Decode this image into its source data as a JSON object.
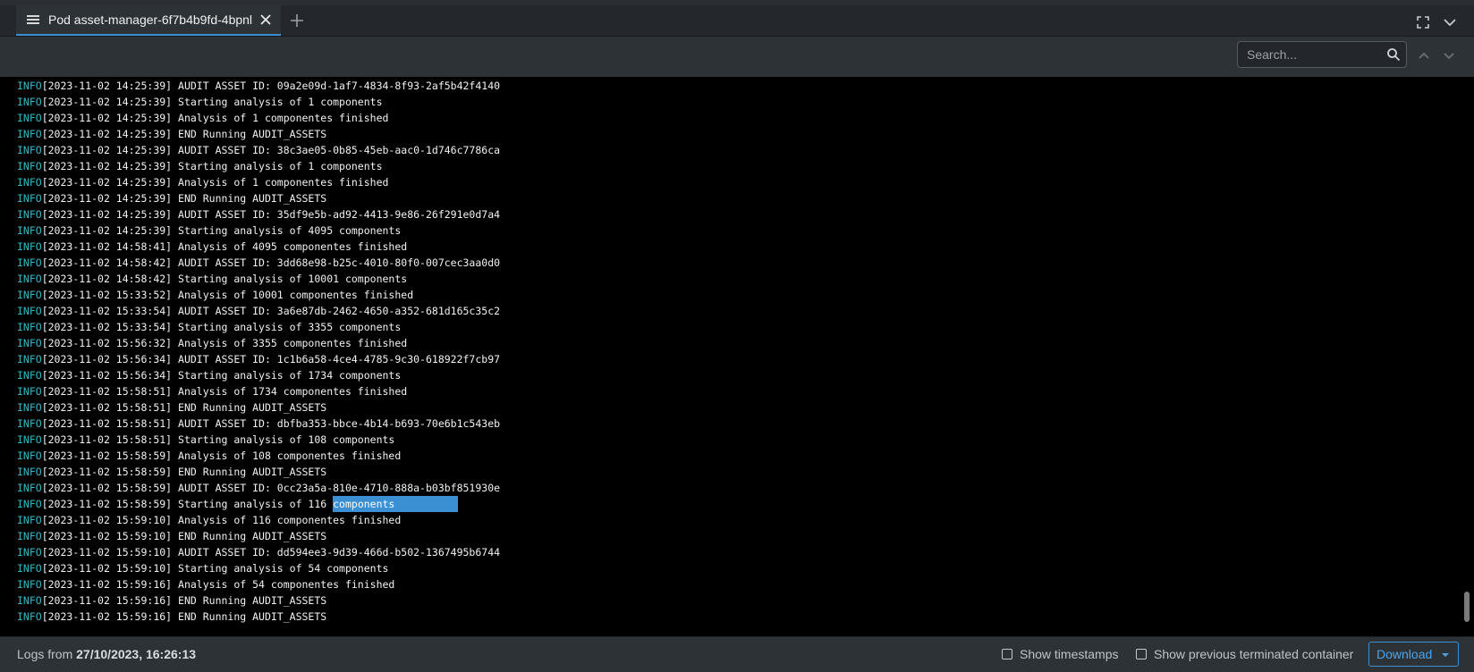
{
  "tabbar": {
    "tab_title": "Pod asset-manager-6f7b4b9fd-4bpnl",
    "tab_icon": "menu-lines-icon",
    "close_icon": "close-icon",
    "add_icon": "plus-icon",
    "fullscreen_icon": "fullscreen-icon",
    "collapse_icon": "chevron-down-icon"
  },
  "toolbar": {
    "search_placeholder": "Search...",
    "search_icon": "search-icon",
    "prev_icon": "chevron-up-icon",
    "next_icon": "chevron-down-icon"
  },
  "logs": {
    "level_label": "INFO",
    "highlighted_text": "components",
    "lines": [
      "[2023-11-02 14:25:39] AUDIT ASSET ID: 09a2e09d-1af7-4834-8f93-2af5b42f4140",
      "[2023-11-02 14:25:39] Starting analysis of 1 components",
      "[2023-11-02 14:25:39] Analysis of 1 componentes finished",
      "[2023-11-02 14:25:39] END Running AUDIT_ASSETS",
      "[2023-11-02 14:25:39] AUDIT ASSET ID: 38c3ae05-0b85-45eb-aac0-1d746c7786ca",
      "[2023-11-02 14:25:39] Starting analysis of 1 components",
      "[2023-11-02 14:25:39] Analysis of 1 componentes finished",
      "[2023-11-02 14:25:39] END Running AUDIT_ASSETS",
      "[2023-11-02 14:25:39] AUDIT ASSET ID: 35df9e5b-ad92-4413-9e86-26f291e0d7a4",
      "[2023-11-02 14:25:39] Starting analysis of 4095 components",
      "[2023-11-02 14:58:41] Analysis of 4095 componentes finished",
      "[2023-11-02 14:58:42] AUDIT ASSET ID: 3dd68e98-b25c-4010-80f0-007cec3aa0d0",
      "[2023-11-02 14:58:42] Starting analysis of 10001 components",
      "[2023-11-02 15:33:52] Analysis of 10001 componentes finished",
      "[2023-11-02 15:33:54] AUDIT ASSET ID: 3a6e87db-2462-4650-a352-681d165c35c2",
      "[2023-11-02 15:33:54] Starting analysis of 3355 components",
      "[2023-11-02 15:56:32] Analysis of 3355 componentes finished",
      "[2023-11-02 15:56:34] AUDIT ASSET ID: 1c1b6a58-4ce4-4785-9c30-618922f7cb97",
      "[2023-11-02 15:56:34] Starting analysis of 1734 components",
      "[2023-11-02 15:58:51] Analysis of 1734 componentes finished",
      "[2023-11-02 15:58:51] END Running AUDIT_ASSETS",
      "[2023-11-02 15:58:51] AUDIT ASSET ID: dbfba353-bbce-4b14-b693-70e6b1c543eb",
      "[2023-11-02 15:58:51] Starting analysis of 108 components",
      "[2023-11-02 15:58:59] Analysis of 108 componentes finished",
      "[2023-11-02 15:58:59] END Running AUDIT_ASSETS",
      "[2023-11-02 15:58:59] AUDIT ASSET ID: 0cc23a5a-810e-4710-888a-b03bf851930e",
      "[2023-11-02 15:58:59] Starting analysis of 116 ",
      "[2023-11-02 15:59:10] Analysis of 116 componentes finished",
      "[2023-11-02 15:59:10] END Running AUDIT_ASSETS",
      "[2023-11-02 15:59:10] AUDIT ASSET ID: dd594ee3-9d39-466d-b502-1367495b6744",
      "[2023-11-02 15:59:10] Starting analysis of 54 components",
      "[2023-11-02 15:59:16] Analysis of 54 componentes finished",
      "[2023-11-02 15:59:16] END Running AUDIT_ASSETS",
      "[2023-11-02 15:59:16] END Running AUDIT_ASSETS"
    ],
    "highlight_line_index": 26
  },
  "footer": {
    "logs_from_label": "Logs from ",
    "logs_from_value": "27/10/2023, 16:26:13",
    "show_timestamps": "Show timestamps",
    "show_previous": "Show previous terminated container",
    "download": "Download"
  },
  "colors": {
    "accent": "#3b8fd3",
    "level": "#2fb8c8",
    "background": "#000000",
    "chrome": "#2d3237"
  }
}
